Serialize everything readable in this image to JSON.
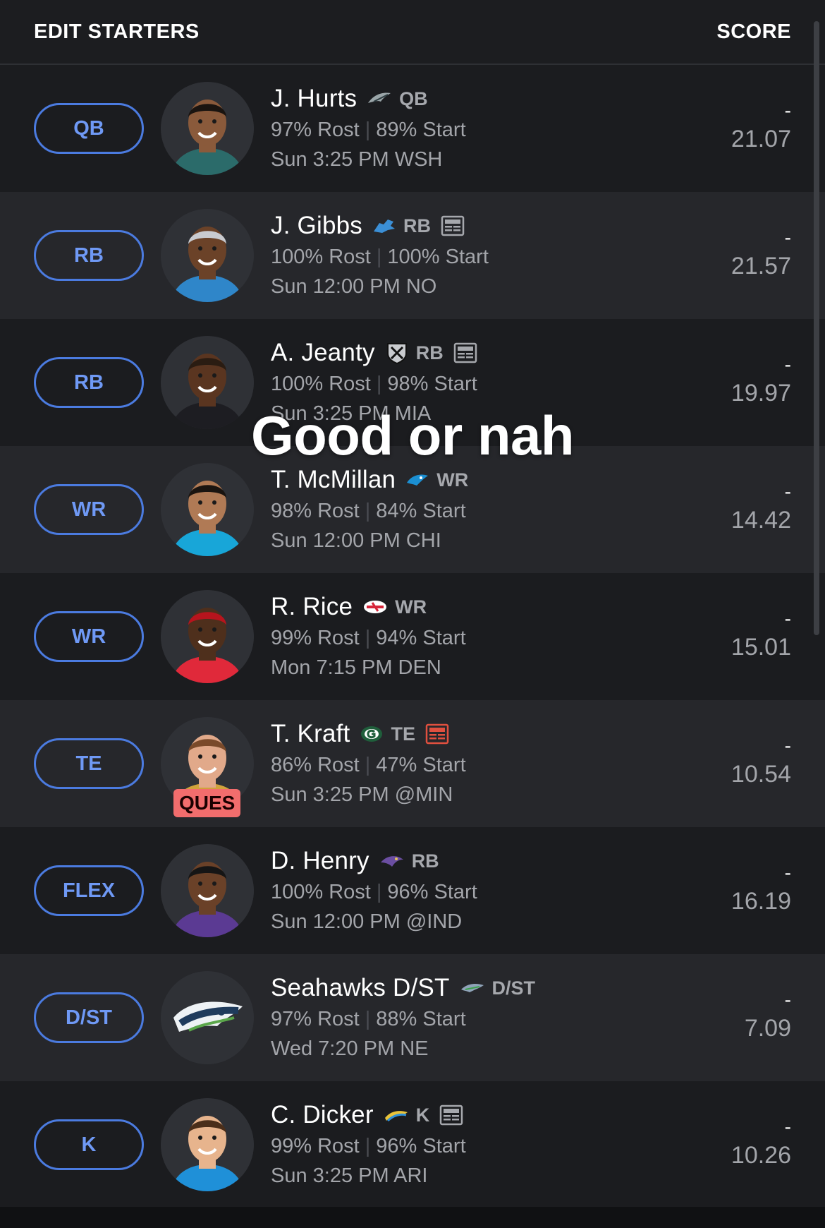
{
  "header": {
    "left": "EDIT STARTERS",
    "right": "SCORE"
  },
  "overlay_text": "Good or nah",
  "rows": [
    {
      "slot": "QB",
      "name": "J. Hurts",
      "team_icon": "eagles-icon",
      "pos": "QB",
      "news": false,
      "rost": "97% Rost",
      "start": "89% Start",
      "game": "Sun  3:25 PM  WSH",
      "dash": "-",
      "proj": "21.07",
      "status": ""
    },
    {
      "slot": "RB",
      "name": "J. Gibbs",
      "team_icon": "lions-icon",
      "pos": "RB",
      "news": true,
      "rost": "100% Rost",
      "start": "100% Start",
      "game": "Sun  12:00 PM  NO",
      "dash": "-",
      "proj": "21.57",
      "status": ""
    },
    {
      "slot": "RB",
      "name": "A. Jeanty",
      "team_icon": "raiders-icon",
      "pos": "RB",
      "news": true,
      "rost": "100% Rost",
      "start": "98% Start",
      "game": "Sun  3:25 PM  MIA",
      "dash": "-",
      "proj": "19.97",
      "status": ""
    },
    {
      "slot": "WR",
      "name": "T. McMillan",
      "team_icon": "panthers-icon",
      "pos": "WR",
      "news": false,
      "rost": "98% Rost",
      "start": "84% Start",
      "game": "Sun  12:00 PM  CHI",
      "dash": "-",
      "proj": "14.42",
      "status": ""
    },
    {
      "slot": "WR",
      "name": "R. Rice",
      "team_icon": "chiefs-icon",
      "pos": "WR",
      "news": false,
      "rost": "99% Rost",
      "start": "94% Start",
      "game": "Mon  7:15 PM  DEN",
      "dash": "-",
      "proj": "15.01",
      "status": ""
    },
    {
      "slot": "TE",
      "name": "T. Kraft",
      "team_icon": "packers-icon",
      "pos": "TE",
      "news": true,
      "news_alert": true,
      "rost": "86% Rost",
      "start": "47% Start",
      "game": "Sun  3:25 PM  @MIN",
      "dash": "-",
      "proj": "10.54",
      "status": "QUES"
    },
    {
      "slot": "FLEX",
      "name": "D. Henry",
      "team_icon": "ravens-icon",
      "pos": "RB",
      "news": false,
      "rost": "100% Rost",
      "start": "96% Start",
      "game": "Sun  12:00 PM  @IND",
      "dash": "-",
      "proj": "16.19",
      "status": ""
    },
    {
      "slot": "D/ST",
      "name": "Seahawks D/ST",
      "team_icon": "seahawks-icon",
      "pos": "D/ST",
      "news": false,
      "rost": "97% Rost",
      "start": "88% Start",
      "game": "Wed  7:20 PM  NE",
      "dash": "-",
      "proj": "7.09",
      "status": ""
    },
    {
      "slot": "K",
      "name": "C. Dicker",
      "team_icon": "chargers-icon",
      "pos": "K",
      "news": true,
      "rost": "99% Rost",
      "start": "96% Start",
      "game": "Sun  3:25 PM  ARI",
      "dash": "-",
      "proj": "10.26",
      "status": ""
    }
  ],
  "colors": {
    "slot_border": "#4b7be0",
    "slot_text": "#6f99f5",
    "ques_badge": "#f26d6d",
    "row_dark": "#1b1c1f",
    "row_light": "#26272b"
  }
}
